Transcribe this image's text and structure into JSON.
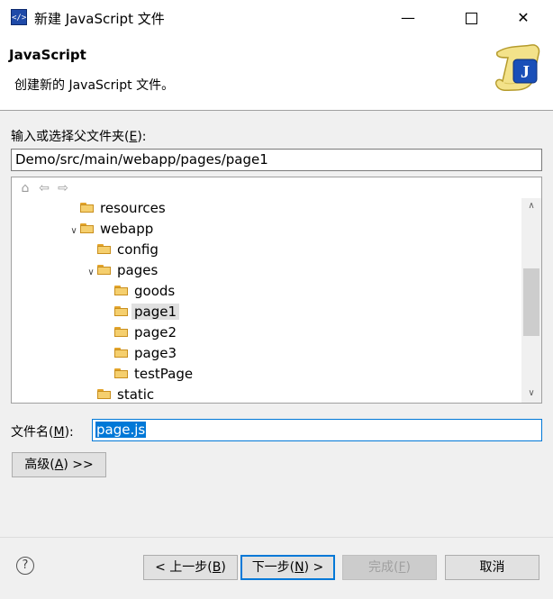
{
  "window": {
    "title": "新建 JavaScript 文件",
    "app_icon": "js-editor-icon"
  },
  "banner": {
    "title": "JavaScript",
    "description": "创建新的 JavaScript 文件。",
    "image_icon": "javascript-scroll-icon"
  },
  "parent_folder": {
    "label_prefix": "输入或选择父文件夹(",
    "label_mnemonic": "E",
    "label_suffix": "):",
    "value": "Demo/src/main/webapp/pages/page1"
  },
  "tree": {
    "toolbar": [
      "home-icon",
      "back-icon",
      "forward-icon"
    ],
    "items": [
      {
        "label": "resources",
        "expanded": false,
        "depth": 3
      },
      {
        "label": "webapp",
        "expanded": true,
        "depth": 2
      },
      {
        "label": "config",
        "expanded": false,
        "depth": 3
      },
      {
        "label": "pages",
        "expanded": true,
        "depth": 3
      },
      {
        "label": "goods",
        "expanded": false,
        "depth": 4
      },
      {
        "label": "page1",
        "expanded": false,
        "depth": 4,
        "selected": true
      },
      {
        "label": "page2",
        "expanded": false,
        "depth": 4
      },
      {
        "label": "page3",
        "expanded": false,
        "depth": 4
      },
      {
        "label": "testPage",
        "expanded": false,
        "depth": 4
      },
      {
        "label": "static",
        "expanded": false,
        "depth": 3
      }
    ]
  },
  "file_name": {
    "label_prefix": "文件名(",
    "label_mnemonic": "M",
    "label_suffix": "):",
    "value": "page.js"
  },
  "buttons": {
    "advanced": {
      "prefix": "高级(",
      "mnemonic": "A",
      "suffix": ") >>"
    },
    "back": {
      "prefix": "< 上一步(",
      "mnemonic": "B",
      "suffix": ")"
    },
    "next": {
      "prefix": "下一步(",
      "mnemonic": "N",
      "suffix": ") >"
    },
    "finish": {
      "prefix": "完成(",
      "mnemonic": "F",
      "suffix": ")"
    },
    "cancel": {
      "label": "取消"
    }
  },
  "colors": {
    "accent": "#0078d7",
    "folder": "#f5cf6e",
    "selected_row": "#e0e0e0"
  }
}
